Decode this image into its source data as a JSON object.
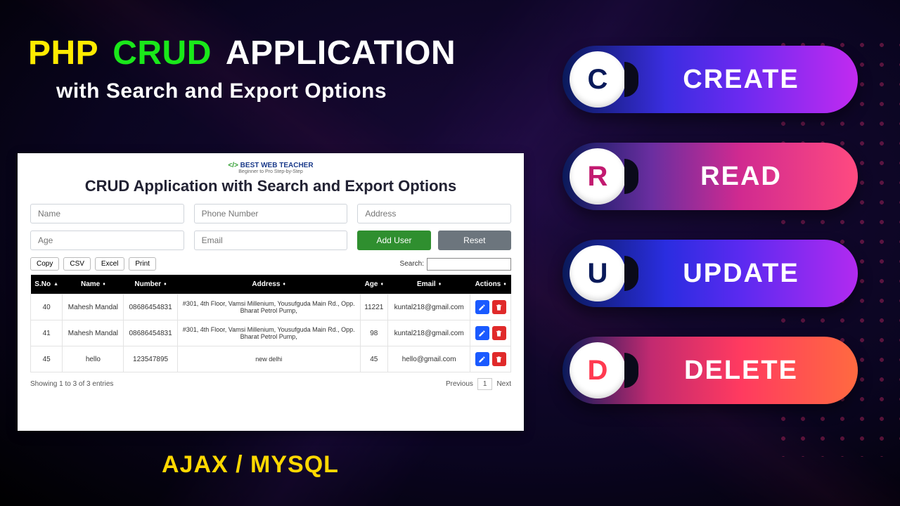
{
  "headline": {
    "php": "PHP",
    "crud": "CRUD",
    "application": "APPLICATION",
    "sub": "with Search and Export Options",
    "footer": "AJAX / MYSQL"
  },
  "pills": {
    "create": {
      "letter": "C",
      "label": "CREATE"
    },
    "read": {
      "letter": "R",
      "label": "READ"
    },
    "update": {
      "letter": "U",
      "label": "UPDATE"
    },
    "delete": {
      "letter": "D",
      "label": "DELETE"
    }
  },
  "panel": {
    "brand_code": "</>",
    "brand_name": "BEST WEB TEACHER",
    "brand_sub": "Beginner to Pro Step-by-Step",
    "title": "CRUD Application with Search and Export Options",
    "inputs": {
      "name": "Name",
      "phone": "Phone Number",
      "address": "Address",
      "age": "Age",
      "email": "Email"
    },
    "buttons": {
      "add": "Add User",
      "reset": "Reset"
    },
    "export": {
      "copy": "Copy",
      "csv": "CSV",
      "excel": "Excel",
      "print": "Print"
    },
    "search_label": "Search:",
    "columns": {
      "sno": "S.No",
      "name": "Name",
      "number": "Number",
      "address": "Address",
      "age": "Age",
      "email": "Email",
      "actions": "Actions"
    },
    "rows": [
      {
        "sno": "40",
        "name": "Mahesh Mandal",
        "number": "08686454831",
        "address": "#301, 4th Floor, Vamsi Millenium, Yousufguda Main Rd., Opp. Bharat Petrol Pump,",
        "age": "11221",
        "email": "kuntal218@gmail.com"
      },
      {
        "sno": "41",
        "name": "Mahesh Mandal",
        "number": "08686454831",
        "address": "#301, 4th Floor, Vamsi Millenium, Yousufguda Main Rd., Opp. Bharat Petrol Pump,",
        "age": "98",
        "email": "kuntal218@gmail.com"
      },
      {
        "sno": "45",
        "name": "hello",
        "number": "123547895",
        "address": "new delhi",
        "age": "45",
        "email": "hello@gmail.com"
      }
    ],
    "info": "Showing 1 to 3 of 3 entries",
    "pager": {
      "prev": "Previous",
      "page": "1",
      "next": "Next"
    }
  }
}
